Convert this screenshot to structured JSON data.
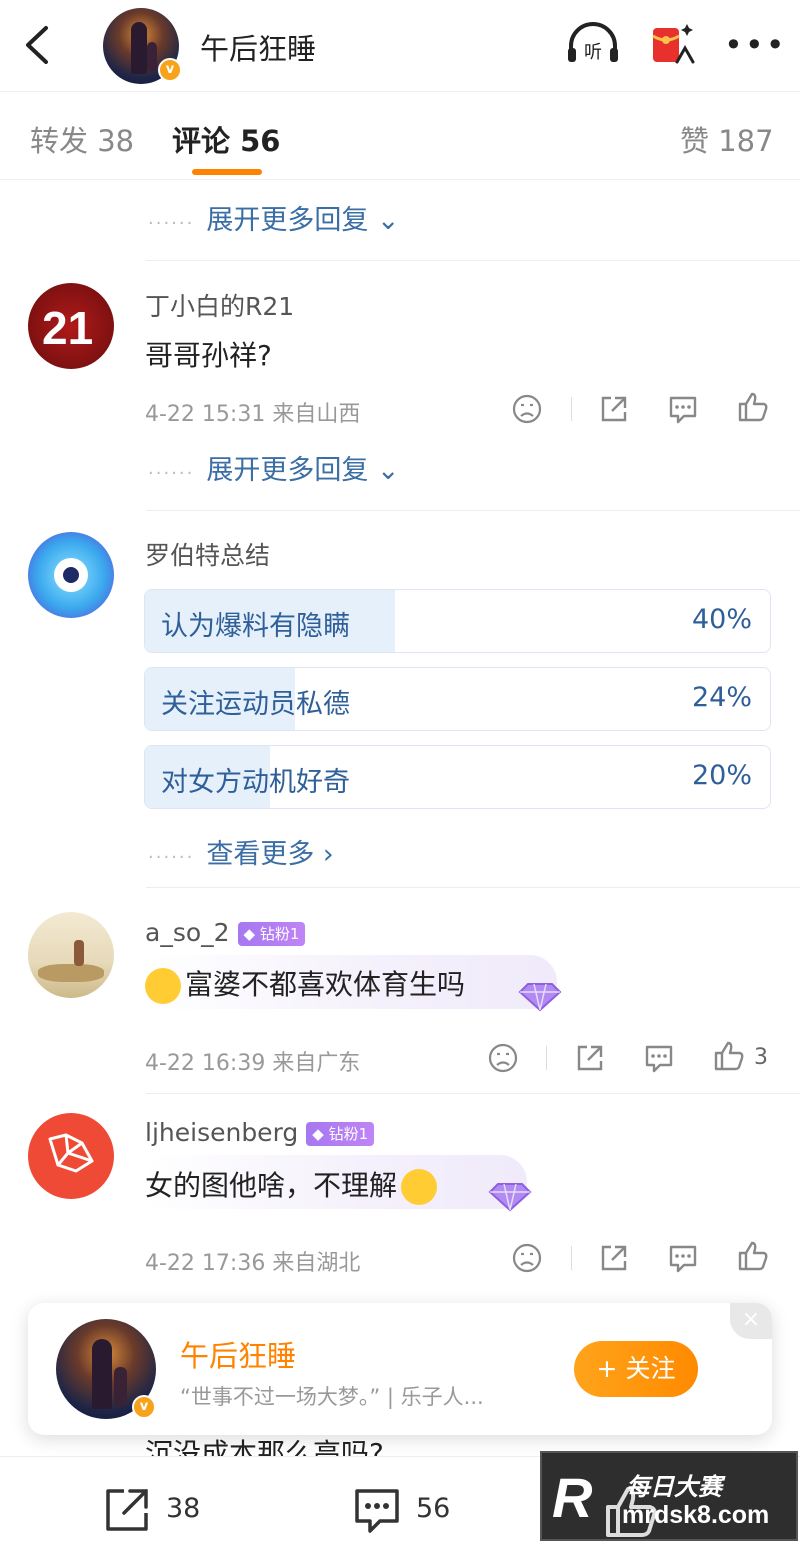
{
  "header": {
    "title": "午后狂睡",
    "verified_mark": "v",
    "listen_label": "听",
    "icons": [
      "back-arrow-icon",
      "headphones-icon",
      "red-packet-icon",
      "more-icon"
    ]
  },
  "tabs": [
    {
      "label": "转发 38"
    },
    {
      "label": "评论 56"
    },
    {
      "label": "赞 187"
    }
  ],
  "expand_label": "展开更多回复",
  "dots": "······",
  "comments": [
    {
      "username": "丁小白的R21",
      "avatar_text": "21",
      "text": "哥哥孙祥?",
      "meta": "4-22 15:31 来自山西"
    },
    {
      "username": "a_so_2",
      "badge": "钻粉1",
      "text": "富婆不都喜欢体育生吗",
      "meta": "4-22 16:39 来自广东",
      "likes": "3"
    },
    {
      "username": "ljheisenberg",
      "badge": "钻粉1",
      "text": "女的图他啥，不理解",
      "meta": "4-22 17:36 来自湖北"
    }
  ],
  "poll": {
    "username": "罗伯特总结",
    "options": [
      {
        "label": "认为爆料有隐瞒",
        "pct": "40%",
        "fraction": 0.4
      },
      {
        "label": "关注运动员私德",
        "pct": "24%",
        "fraction": 0.24
      },
      {
        "label": "对女方动机好奇",
        "pct": "20%",
        "fraction": 0.2
      }
    ],
    "see_more": "查看更多 ›"
  },
  "popup": {
    "name": "午后狂睡",
    "bio": "“世事不过一场大梦。” | 乐子人...",
    "follow_label": "+ 关注",
    "close": "×"
  },
  "hidden_comment_text": "沉没成本那么高吗?",
  "bottom_bar": {
    "repost_count": "38",
    "comment_count": "56"
  },
  "watermark": {
    "logo": "R",
    "cn": "每日大赛",
    "url": "mrdsk8.com"
  },
  "colors": {
    "accent": "#ff8200",
    "link": "#3a6ea5",
    "poll_text": "#2f5f99",
    "badge": "#a678f0"
  }
}
